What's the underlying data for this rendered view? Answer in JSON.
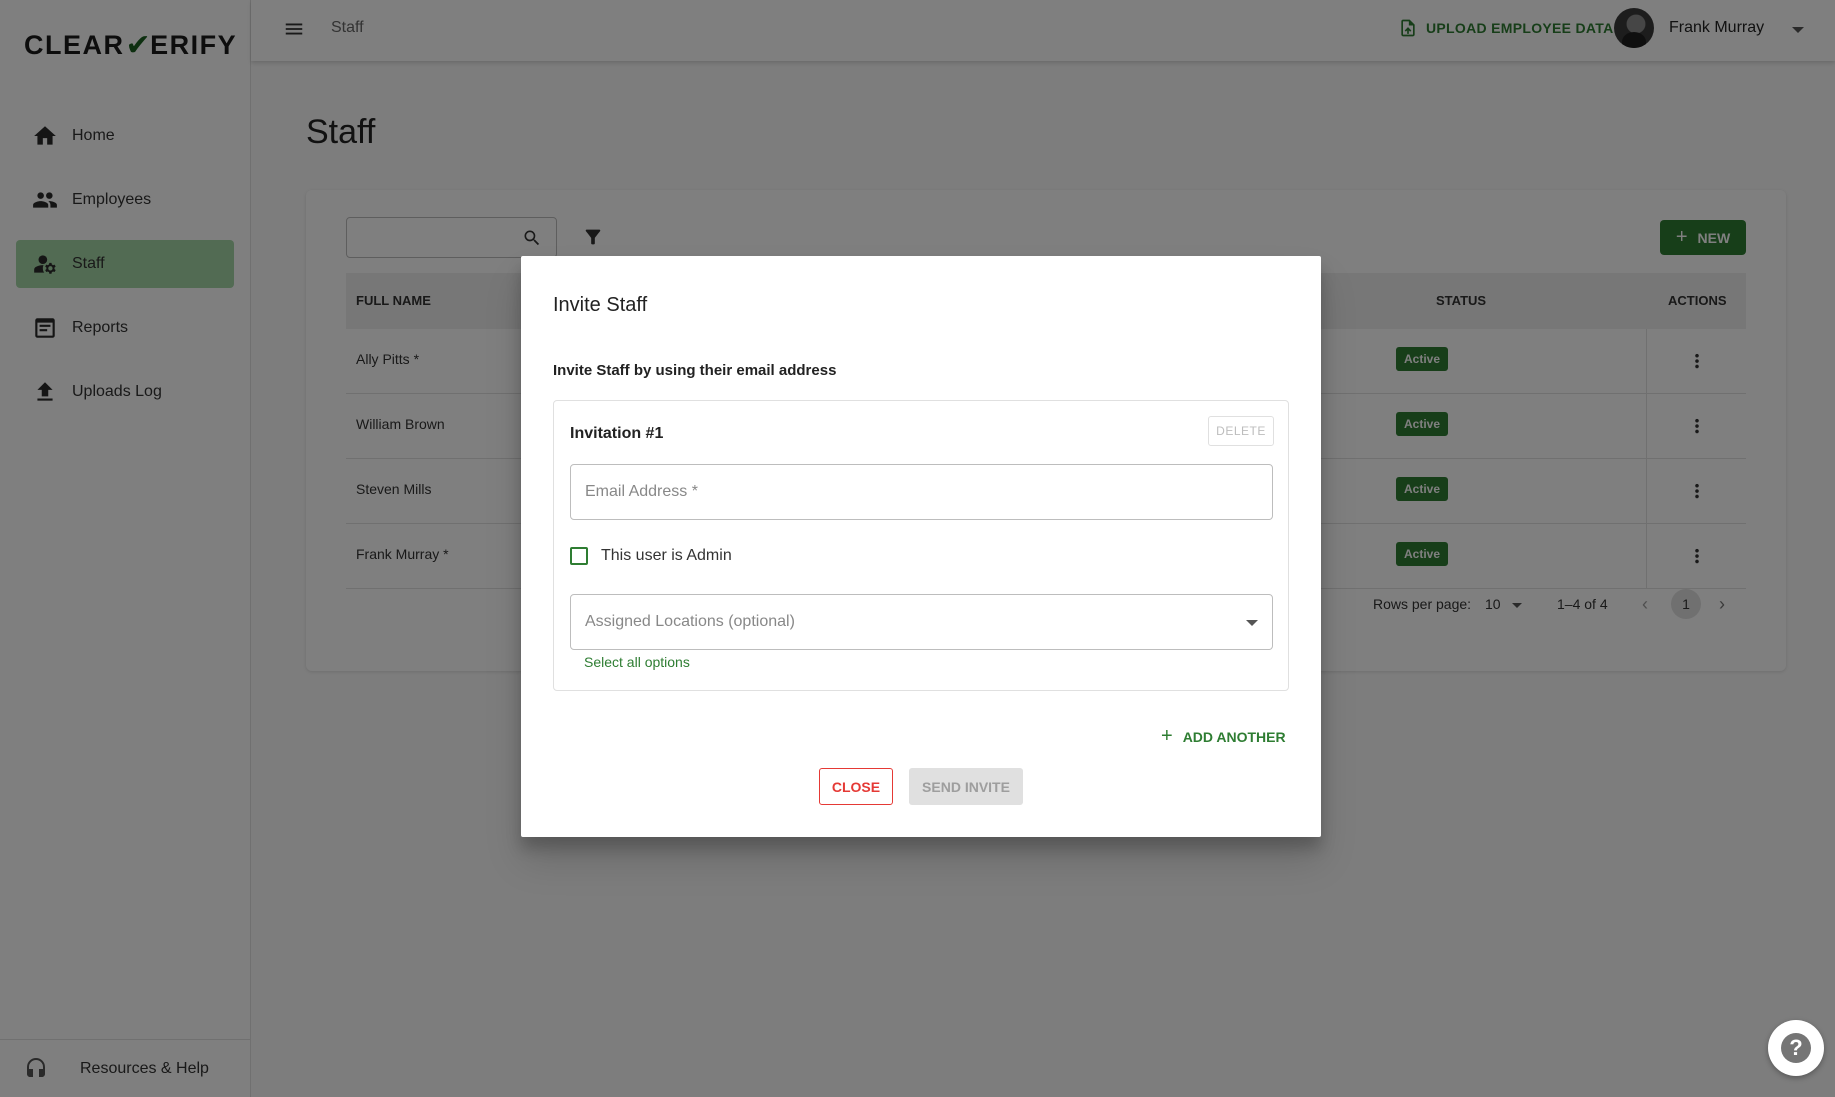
{
  "app": {
    "logo_text": "CLEAR✔ERIFY",
    "breadcrumb": "Staff",
    "upload_label": "UPLOAD EMPLOYEE DATA",
    "user_name": "Frank Murray"
  },
  "sidebar": {
    "items": [
      {
        "label": "Home",
        "icon": "home-icon",
        "active": false
      },
      {
        "label": "Employees",
        "icon": "people-icon",
        "active": false
      },
      {
        "label": "Staff",
        "icon": "staff-settings-icon",
        "active": true
      },
      {
        "label": "Reports",
        "icon": "reports-icon",
        "active": false
      },
      {
        "label": "Uploads Log",
        "icon": "upload-icon",
        "active": false
      }
    ],
    "footer_label": "Resources & Help"
  },
  "page": {
    "title": "Staff",
    "new_button": "NEW"
  },
  "table": {
    "columns": {
      "name": "FULL NAME",
      "status": "STATUS",
      "actions": "ACTIONS"
    },
    "rows": [
      {
        "name": "Ally Pitts *",
        "status": "Active"
      },
      {
        "name": "William Brown",
        "status": "Active"
      },
      {
        "name": "Steven Mills",
        "status": "Active"
      },
      {
        "name": "Frank Murray *",
        "status": "Active"
      }
    ],
    "pagination": {
      "rows_per_page_label": "Rows per page:",
      "rows_per_page": "10",
      "range": "1–4 of 4",
      "page": "1"
    }
  },
  "dialog": {
    "title": "Invite Staff",
    "subtitle": "Invite Staff by using their email address",
    "invitation_title": "Invitation #1",
    "delete_label": "DELETE",
    "email_placeholder": "Email Address *",
    "admin_label": "This user is Admin",
    "admin_checked": false,
    "locations_placeholder": "Assigned Locations (optional)",
    "select_all": "Select all options",
    "add_another": "ADD ANOTHER",
    "close": "CLOSE",
    "send": "SEND INVITE"
  },
  "colors": {
    "brand_green": "#2e7d32",
    "active_nav": "#a5d6a7",
    "close_red": "#e53935"
  }
}
